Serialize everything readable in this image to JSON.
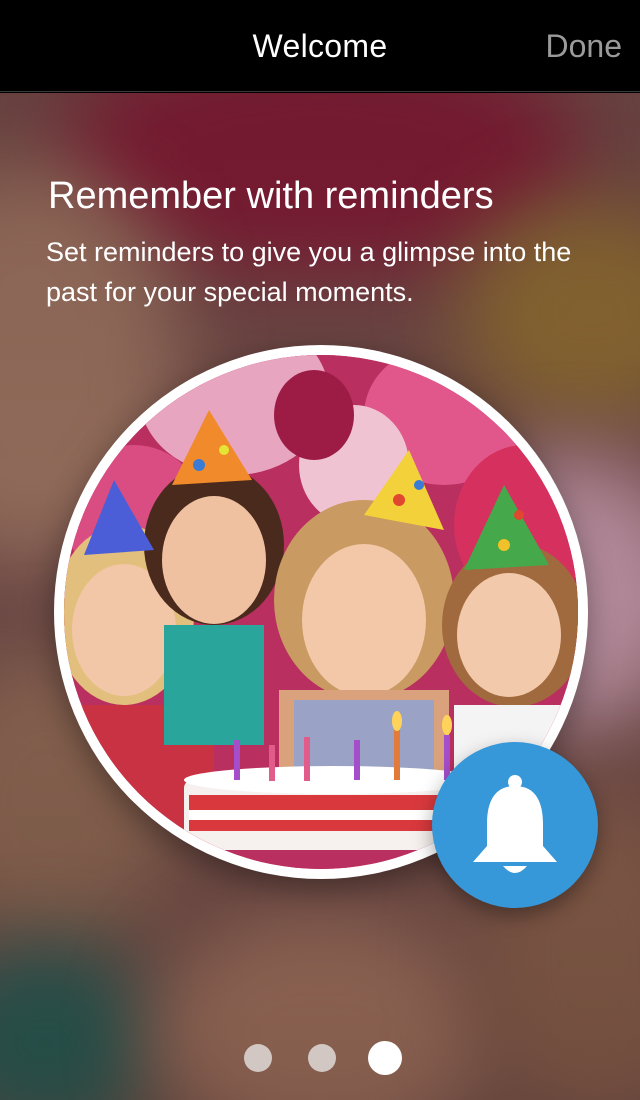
{
  "navbar": {
    "title": "Welcome",
    "done_label": "Done"
  },
  "content": {
    "headline": "Remember with reminders",
    "description": "Set reminders to give you a glimpse into the past for your special moments."
  },
  "photo": {
    "subject": "birthday-party-photo"
  },
  "reminder_button": {
    "icon": "bell-icon",
    "color": "#3697d9"
  },
  "pagination": {
    "total": 3,
    "current": 3
  }
}
